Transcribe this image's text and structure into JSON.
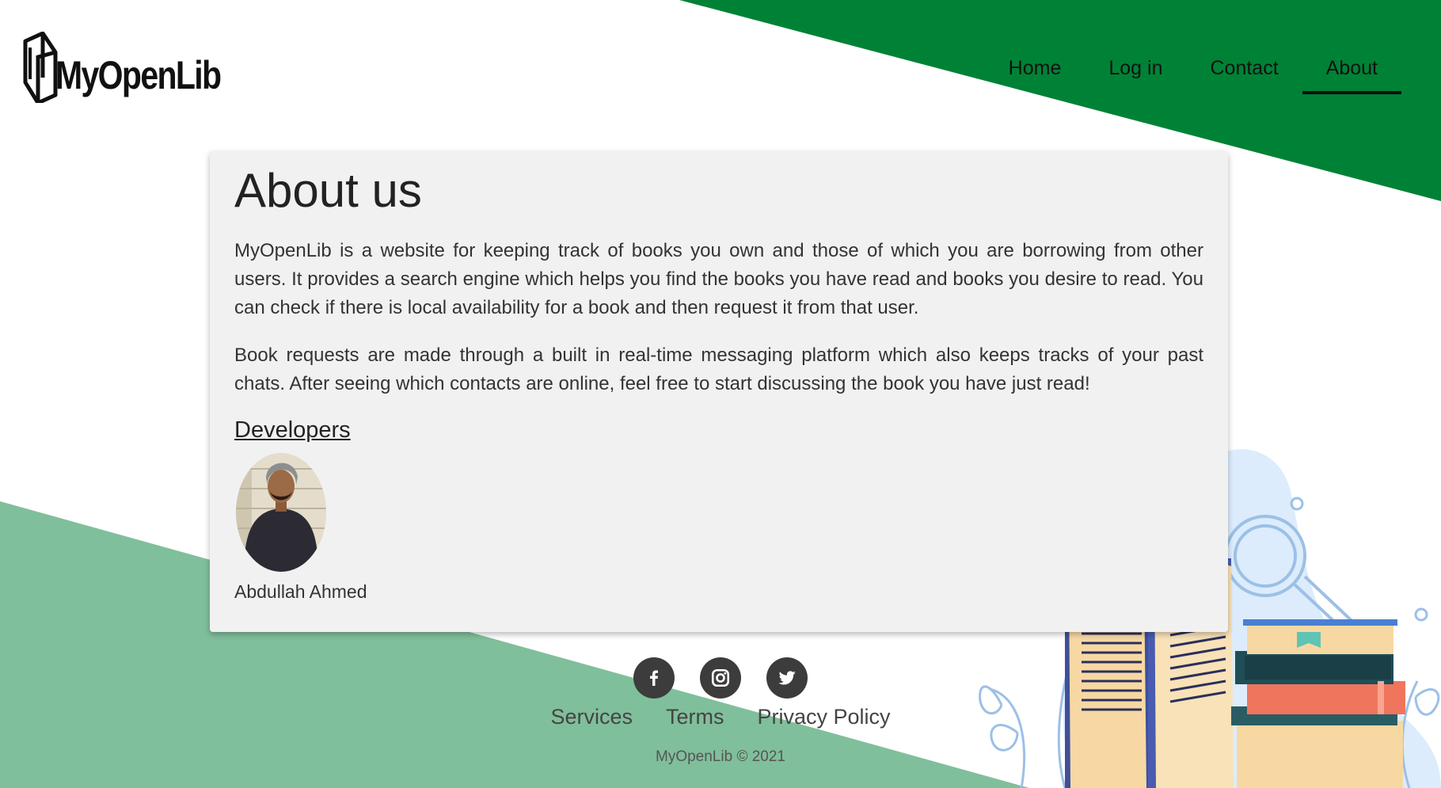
{
  "brand": {
    "name": "MyOpenLib"
  },
  "nav": {
    "items": [
      {
        "label": "Home"
      },
      {
        "label": "Log in"
      },
      {
        "label": "Contact"
      },
      {
        "label": "About",
        "active": true
      }
    ]
  },
  "about": {
    "title": "About us",
    "paragraphs": [
      "MyOpenLib is a website for keeping track of books you own and those of which you are borrowing from other users. It provides a search engine which helps you find the books you have read and books you desire to read. You can check if there is local availability for a book and then request it from that user.",
      "Book requests are made through a built in real-time messaging platform which also keeps tracks of your past chats. After seeing which contacts are online, feel free to start discussing the book you have just read!"
    ],
    "developers_heading": "Developers",
    "developers": [
      {
        "name": "Abdullah Ahmed"
      }
    ]
  },
  "footer": {
    "socials": [
      {
        "icon": "facebook-icon"
      },
      {
        "icon": "instagram-icon"
      },
      {
        "icon": "twitter-icon"
      }
    ],
    "links": [
      {
        "label": "Services"
      },
      {
        "label": "Terms"
      },
      {
        "label": "Privacy Policy"
      }
    ],
    "copyright": "MyOpenLib © 2021"
  },
  "colors": {
    "dark_green": "#008236",
    "light_green": "#80bf9b",
    "card": "#f1f1f1",
    "blob": "#dcecfc"
  }
}
